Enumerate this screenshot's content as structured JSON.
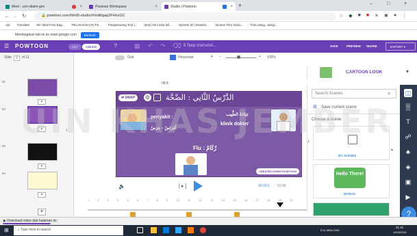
{
  "browser": {
    "tabs": [
      {
        "label": "Meet - czn-nbwm-gov"
      },
      {
        "label": "Powtoon Workspace"
      },
      {
        "label": "Studio | Powtoon"
      }
    ],
    "new_tab": "+",
    "url": "powtoon.com/html5-studio/#/edit/gap3FHnzGC",
    "bookmarks": [
      "Apl",
      "Translate",
      "05+ Best Free Bag...",
      "PELAKSANAAN P2...",
      "Paraphrasing Tool |...",
      "(604) Yeni inka full...",
      "Spinner ID | Rewrite...",
      "Nonton Film Indon...",
      "Tulis ulang, ulangi..."
    ],
    "share_notice": "Membagikan tab ini ke meet.google.com",
    "share_button": "Berhenti"
  },
  "powtoon": {
    "logo": "POWTOON",
    "edit_label": "EDIT",
    "create_label": "CREATE",
    "title": "8 Step Instructio...",
    "save": "SAVE",
    "preview": "PREVIEW",
    "share": "SHARE",
    "export": "EXPORT"
  },
  "slides": {
    "label": "Slide",
    "current": "2",
    "of": "of 11",
    "numbers": [
      "01",
      "02",
      "03",
      "04"
    ]
  },
  "canvas_toolbar": {
    "grid": "Grid",
    "orientation": "Horizontal",
    "zoom": "100%",
    "time_marker": "08.8"
  },
  "slide": {
    "title": "الدَّرْسُ الثَّانِي : الصِّحَّة",
    "swap": "SWAP",
    "penyakit": "penyakit :",
    "arabic_penyakit": "أَمْرَاضٌ - مَرَضٌ",
    "arabic_klinik": "عِيَادَةُ الطَّبِيب",
    "klinik": "klinik dokter",
    "flu": "Flu : زُكَامٌ",
    "badge": "CREATED USING POWTOON"
  },
  "player": {
    "bracket": "[ ▸ ]",
    "time_current": "00:00.5",
    "time_total": "01:50"
  },
  "timeline_ticks": [
    "1",
    "2",
    "3",
    "4",
    "5",
    "6",
    "7",
    "8",
    "9",
    "10",
    "11",
    "12",
    "13",
    "14",
    "15",
    "16",
    "17",
    "18",
    "19",
    "20"
  ],
  "right_panel": {
    "look": "CARTOON LOOK",
    "search_placeholder": "Search Scenes",
    "save_scene": "Save current scene",
    "choose": "Choose a scene",
    "my_scenes": "MY SCENES",
    "intros": "INTROS",
    "hello": "Hello There!"
  },
  "download_bar": {
    "text": "Download video dari halaman ini"
  },
  "taskbar": {
    "search": "Type here to search",
    "status": "0.01 MB/s ENG",
    "time": "21:41",
    "date": "10/03/2021"
  },
  "watermark": "UIN KHAS JEMBER",
  "colors": {
    "powtoon_purple": "#6a3fb5",
    "slide_bg": "#7c5aa6",
    "accent_blue": "#1a73e8"
  }
}
